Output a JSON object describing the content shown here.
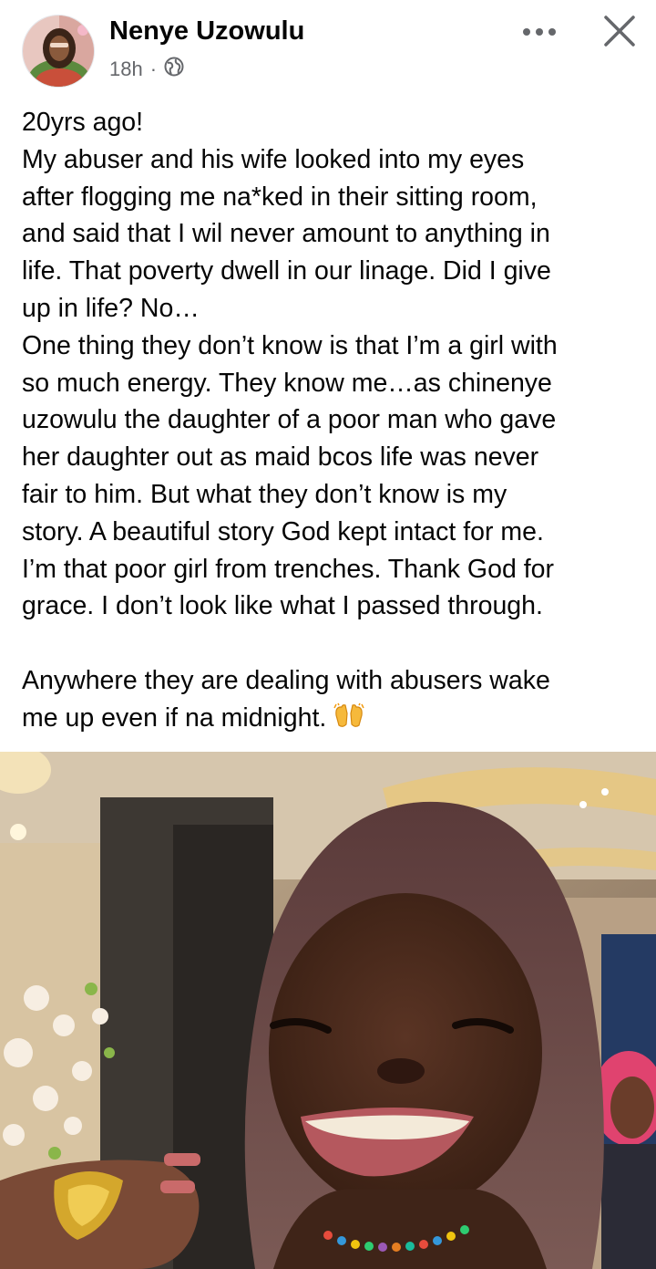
{
  "post": {
    "author": "Nenye Uzowulu",
    "time": "18h",
    "separator": "·",
    "audience_icon": "globe-icon",
    "more_icon": "more-dots-icon",
    "close_icon": "close-icon",
    "text_lines": [
      "20yrs ago!",
      "My abuser and his wife looked into my eyes",
      "after flogging me na*ked in their sitting room,",
      "and said that I wil never amount to anything in",
      "life. That poverty dwell in our linage. Did I give",
      "up in life? No…",
      "One thing they don’t know is that I’m a girl with",
      "so much energy. They know me…as chinenye",
      "uzowulu the daughter of a poor man who gave",
      "her daughter out as maid bcos life was never",
      "fair to him. But what they don’t know is my",
      "story. A beautiful story God kept intact for me.",
      "I’m that poor girl from trenches. Thank God for",
      "grace.  I don’t look like what I passed through.",
      "",
      "Anywhere they are dealing with abusers wake",
      "me up even if na midnight. "
    ],
    "emoji": "raising-hands-emoji"
  },
  "colors": {
    "text": "#050505",
    "secondary": "#65676b"
  }
}
